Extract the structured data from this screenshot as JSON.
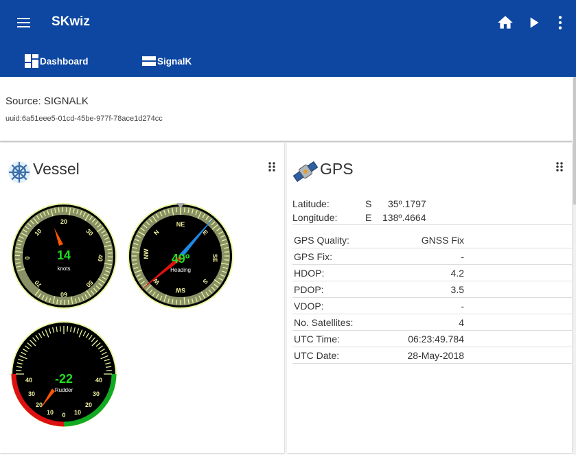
{
  "app": {
    "title": "SKwiz"
  },
  "tabs": [
    {
      "label": "Dashboard"
    },
    {
      "label": "SignalK"
    }
  ],
  "source": {
    "label": "Source: SIGNALK",
    "uuid": "uuid:6a51eee5-01cd-45be-977f-78ace1d274cc"
  },
  "vessel": {
    "title": "Vessel",
    "speed": {
      "value": "14",
      "unit": "knots",
      "ticks": [
        "0",
        "10",
        "20",
        "30",
        "40",
        "50",
        "60",
        "70"
      ]
    },
    "heading": {
      "value": "49º",
      "label": "Heading",
      "cardinals": [
        "NE",
        "SE",
        "SW",
        "NW"
      ],
      "letters": [
        "N",
        "E",
        "S",
        "W"
      ]
    },
    "rudder": {
      "value": "-22",
      "label": "Rudder",
      "ticks": [
        "40",
        "30",
        "20",
        "10",
        "0",
        "10",
        "20",
        "30",
        "40"
      ]
    }
  },
  "gps": {
    "title": "GPS",
    "latitude": {
      "label": "Latitude:",
      "hemisphere": "S",
      "value": "35º.1797"
    },
    "longitude": {
      "label": "Longitude:",
      "hemisphere": "E",
      "value": "138º.4664"
    },
    "rows": [
      {
        "label": "GPS Quality:",
        "value": "GNSS Fix"
      },
      {
        "label": "GPS Fix:",
        "value": "-"
      },
      {
        "label": "HDOP:",
        "value": "4.2"
      },
      {
        "label": "PDOP:",
        "value": "3.5"
      },
      {
        "label": "VDOP:",
        "value": "-"
      },
      {
        "label": "No. Satellites:",
        "value": "4"
      },
      {
        "label": "UTC Time:",
        "value": "06:23:49.784"
      },
      {
        "label": "UTC Date:",
        "value": "28-May-2018"
      }
    ]
  },
  "icons": {
    "menu": "menu-icon",
    "home": "home-icon",
    "play": "play-icon",
    "more": "more-vert-icon",
    "dashboard": "dashboard-icon",
    "signalk": "signalk-icon",
    "vessel": "helm-wheel-icon",
    "gps": "satellite-icon",
    "drag": "drag-handle-icon"
  },
  "colors": {
    "appbar": "#0d47a1",
    "gauge_value": "#22dd22",
    "needle": "#ff5500",
    "port": "#dd1111",
    "starboard": "#11aa22",
    "heading_up": "#1e88e5"
  }
}
